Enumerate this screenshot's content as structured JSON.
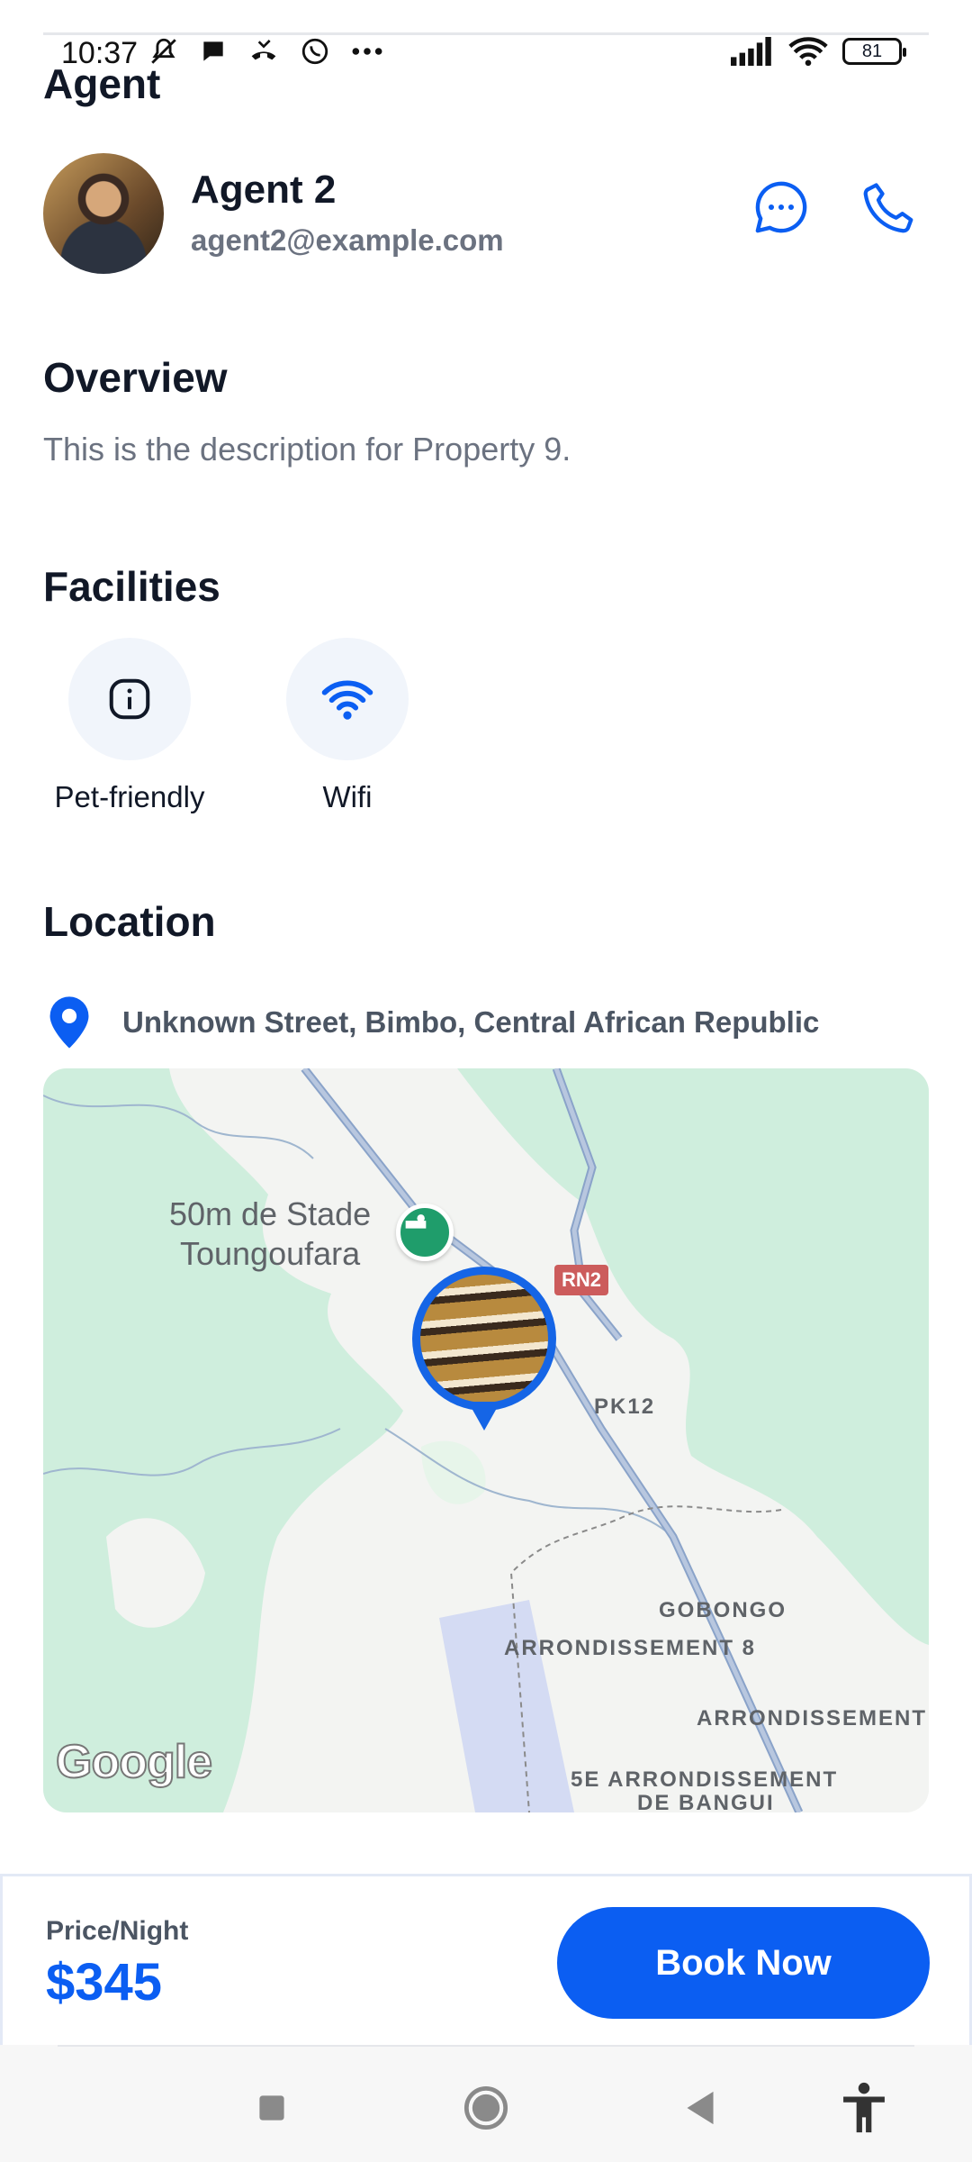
{
  "status_bar": {
    "time": "10:37",
    "battery": "81",
    "icons_left": [
      "mute-icon",
      "chat-bubble-icon",
      "missed-call-icon",
      "whatsapp-icon",
      "more-dots-icon"
    ],
    "icons_right": [
      "signal-icon",
      "wifi-icon",
      "battery-icon"
    ]
  },
  "agent": {
    "section_title": "Agent",
    "name": "Agent 2",
    "email": "agent2@example.com",
    "actions": [
      "message-icon",
      "phone-icon"
    ]
  },
  "overview": {
    "title": "Overview",
    "description": "This is the description for Property 9."
  },
  "facilities": {
    "title": "Facilities",
    "items": [
      {
        "label": "Pet-friendly",
        "icon": "info-icon"
      },
      {
        "label": "Wifi",
        "icon": "wifi-icon"
      }
    ]
  },
  "location": {
    "title": "Location",
    "address": "Unknown Street, Bimbo, Central African Republic",
    "map": {
      "place_name": "50m de Stade\nToungoufara",
      "road_badge": "RN2",
      "labels": {
        "pk12": "PK12",
        "gobongo": "GOBONGO",
        "arr8": "ARRONDISSEMENT 8",
        "arr": "ARRONDISSEMENT",
        "arr5_line1": "5E ARRONDISSEMENT",
        "arr5_line2": "DE BANGUI"
      },
      "attribution": "Google"
    }
  },
  "booking": {
    "price_label": "Price/Night",
    "price": "$345",
    "button_label": "Book Now"
  },
  "colors": {
    "primary": "#0b5ef2",
    "title": "#111827",
    "muted": "#6b7280",
    "map_green": "#cfeedd",
    "marker": "#1565e6"
  },
  "navigation": [
    "recents-square-icon",
    "home-circle-icon",
    "back-triangle-icon",
    "accessibility-icon"
  ]
}
